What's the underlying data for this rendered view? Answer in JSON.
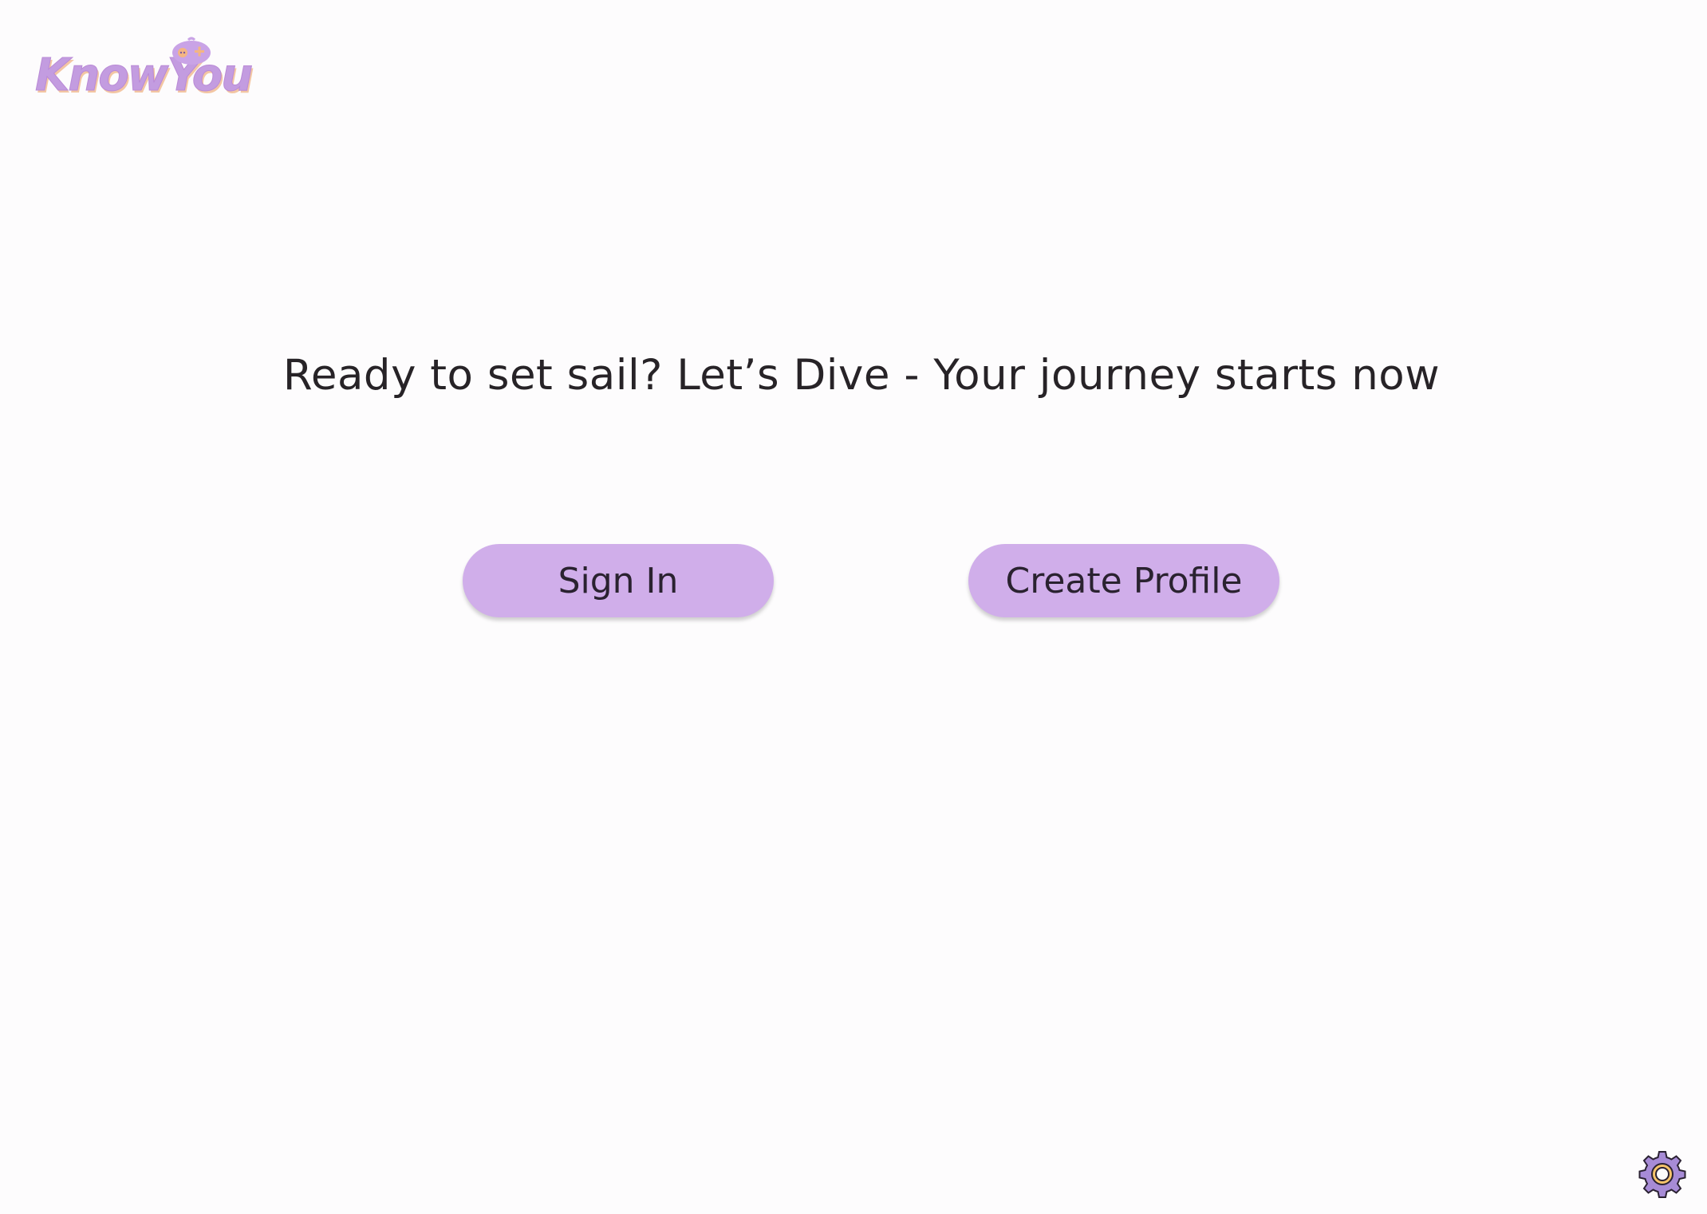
{
  "brand": {
    "logo_text": "KnowYou",
    "logo_color": "#c39ce0",
    "logo_accent": "#f3b583"
  },
  "main": {
    "headline": "Ready to set sail? Let’s Dive - Your journey starts now",
    "sign_in_label": "Sign In",
    "create_profile_label": "Create Profile"
  },
  "footer": {
    "settings_icon": "gear-icon"
  },
  "colors": {
    "background": "#fdfcfd",
    "button": "#d0aeea",
    "text": "#272327",
    "gear_fill": "#a78bd6",
    "gear_center": "#f6c36a"
  }
}
